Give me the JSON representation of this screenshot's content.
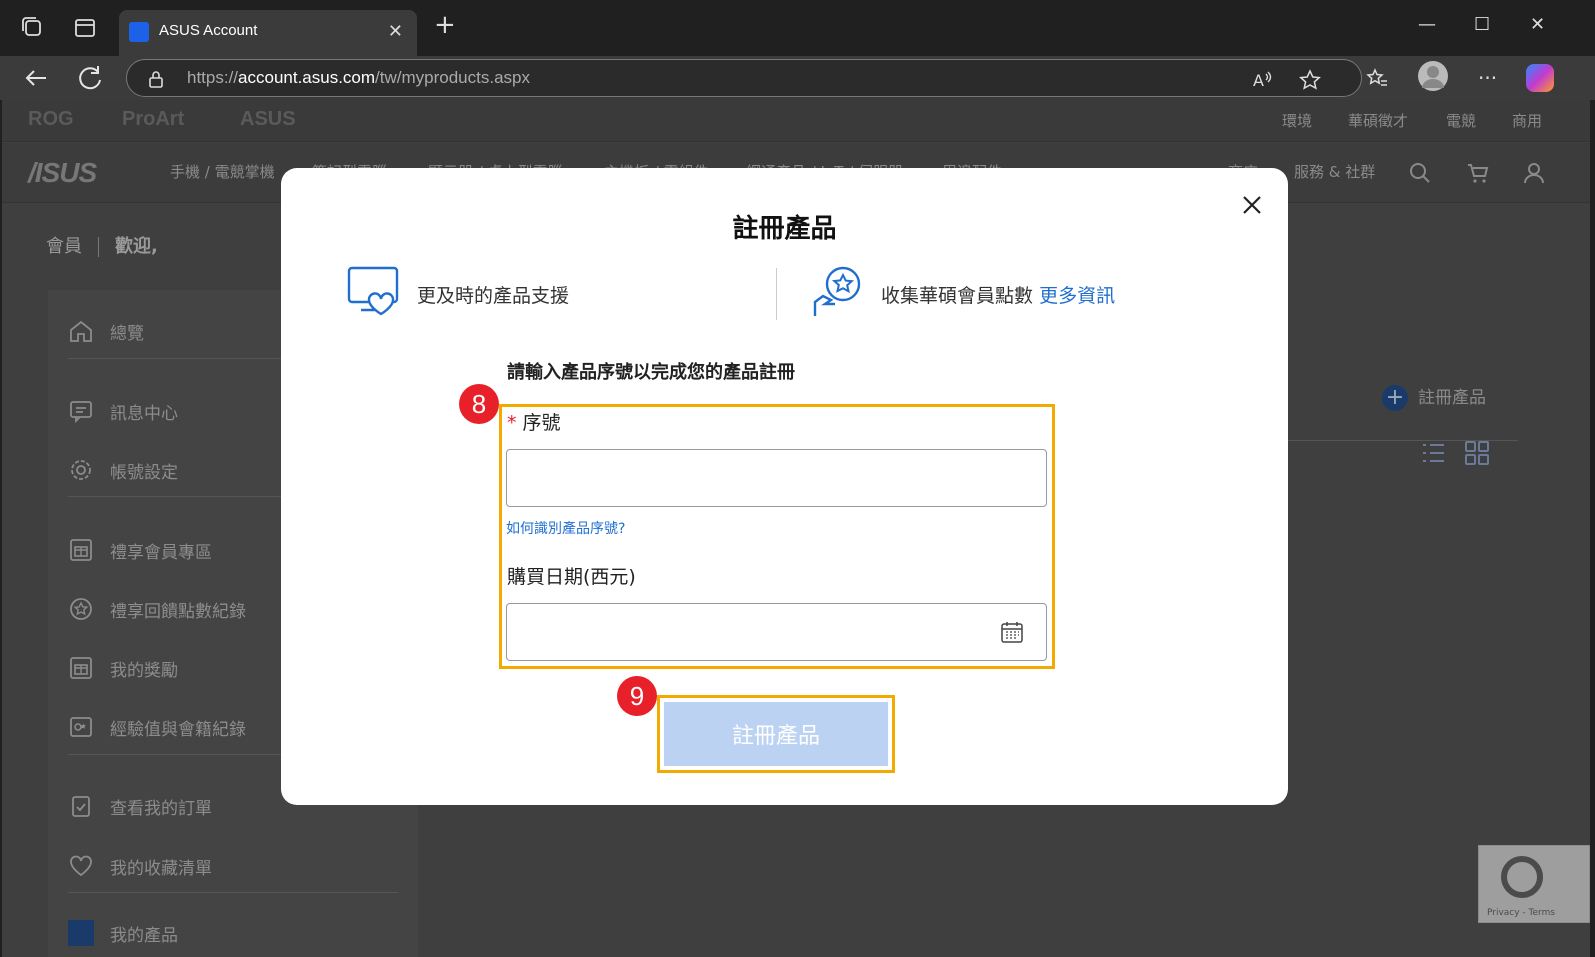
{
  "browser": {
    "tab_title": "ASUS Account",
    "url_prefix": "https://",
    "url_host": "account.asus.com",
    "url_path": "/tw/myproducts.aspx"
  },
  "site": {
    "brands": [
      "ROG",
      "ProArt",
      "ASUS"
    ],
    "top_links": [
      "環境",
      "華碩徵才",
      "電競",
      "商用"
    ],
    "logo": "/ISUS",
    "nav": [
      "手機 / 電競掌機",
      "筆記型電腦",
      "顯示器 / 桌上型電腦",
      "主機板 / 零組件",
      "網通產品 / IoT / 伺服器",
      "周邊配件",
      "商店",
      "服務 & 社群"
    ],
    "breadcrumb": {
      "section": "會員",
      "greeting": "歡迎,"
    },
    "sidebar": [
      "總覽",
      "訊息中心",
      "帳號設定",
      "禮享會員專區",
      "禮享回饋點數紀錄",
      "我的獎勵",
      "經驗值與會籍紀錄",
      "查看我的訂單",
      "我的收藏清單",
      "我的產品"
    ],
    "add_product": "註冊產品",
    "recaptcha": "Privacy - Terms"
  },
  "modal": {
    "title": "註冊產品",
    "benefit_support": "更及時的產品支援",
    "benefit_points": "收集華碩會員點數",
    "more_info": "更多資訊",
    "instruction": "請輸入產品序號以完成您的產品註冊",
    "serial_required_mark": "*",
    "serial_label": "序號",
    "serial_value": "",
    "serial_help": "如何識別產品序號?",
    "date_label": "購買日期(西元)",
    "date_value": "",
    "submit_label": "註冊產品"
  },
  "annotations": {
    "step_a": "8",
    "step_b": "9"
  },
  "colors": {
    "highlight": "#f2a900",
    "badge": "#e8202a",
    "link": "#1f6fd0",
    "submit_bg": "#bcd2f2"
  }
}
